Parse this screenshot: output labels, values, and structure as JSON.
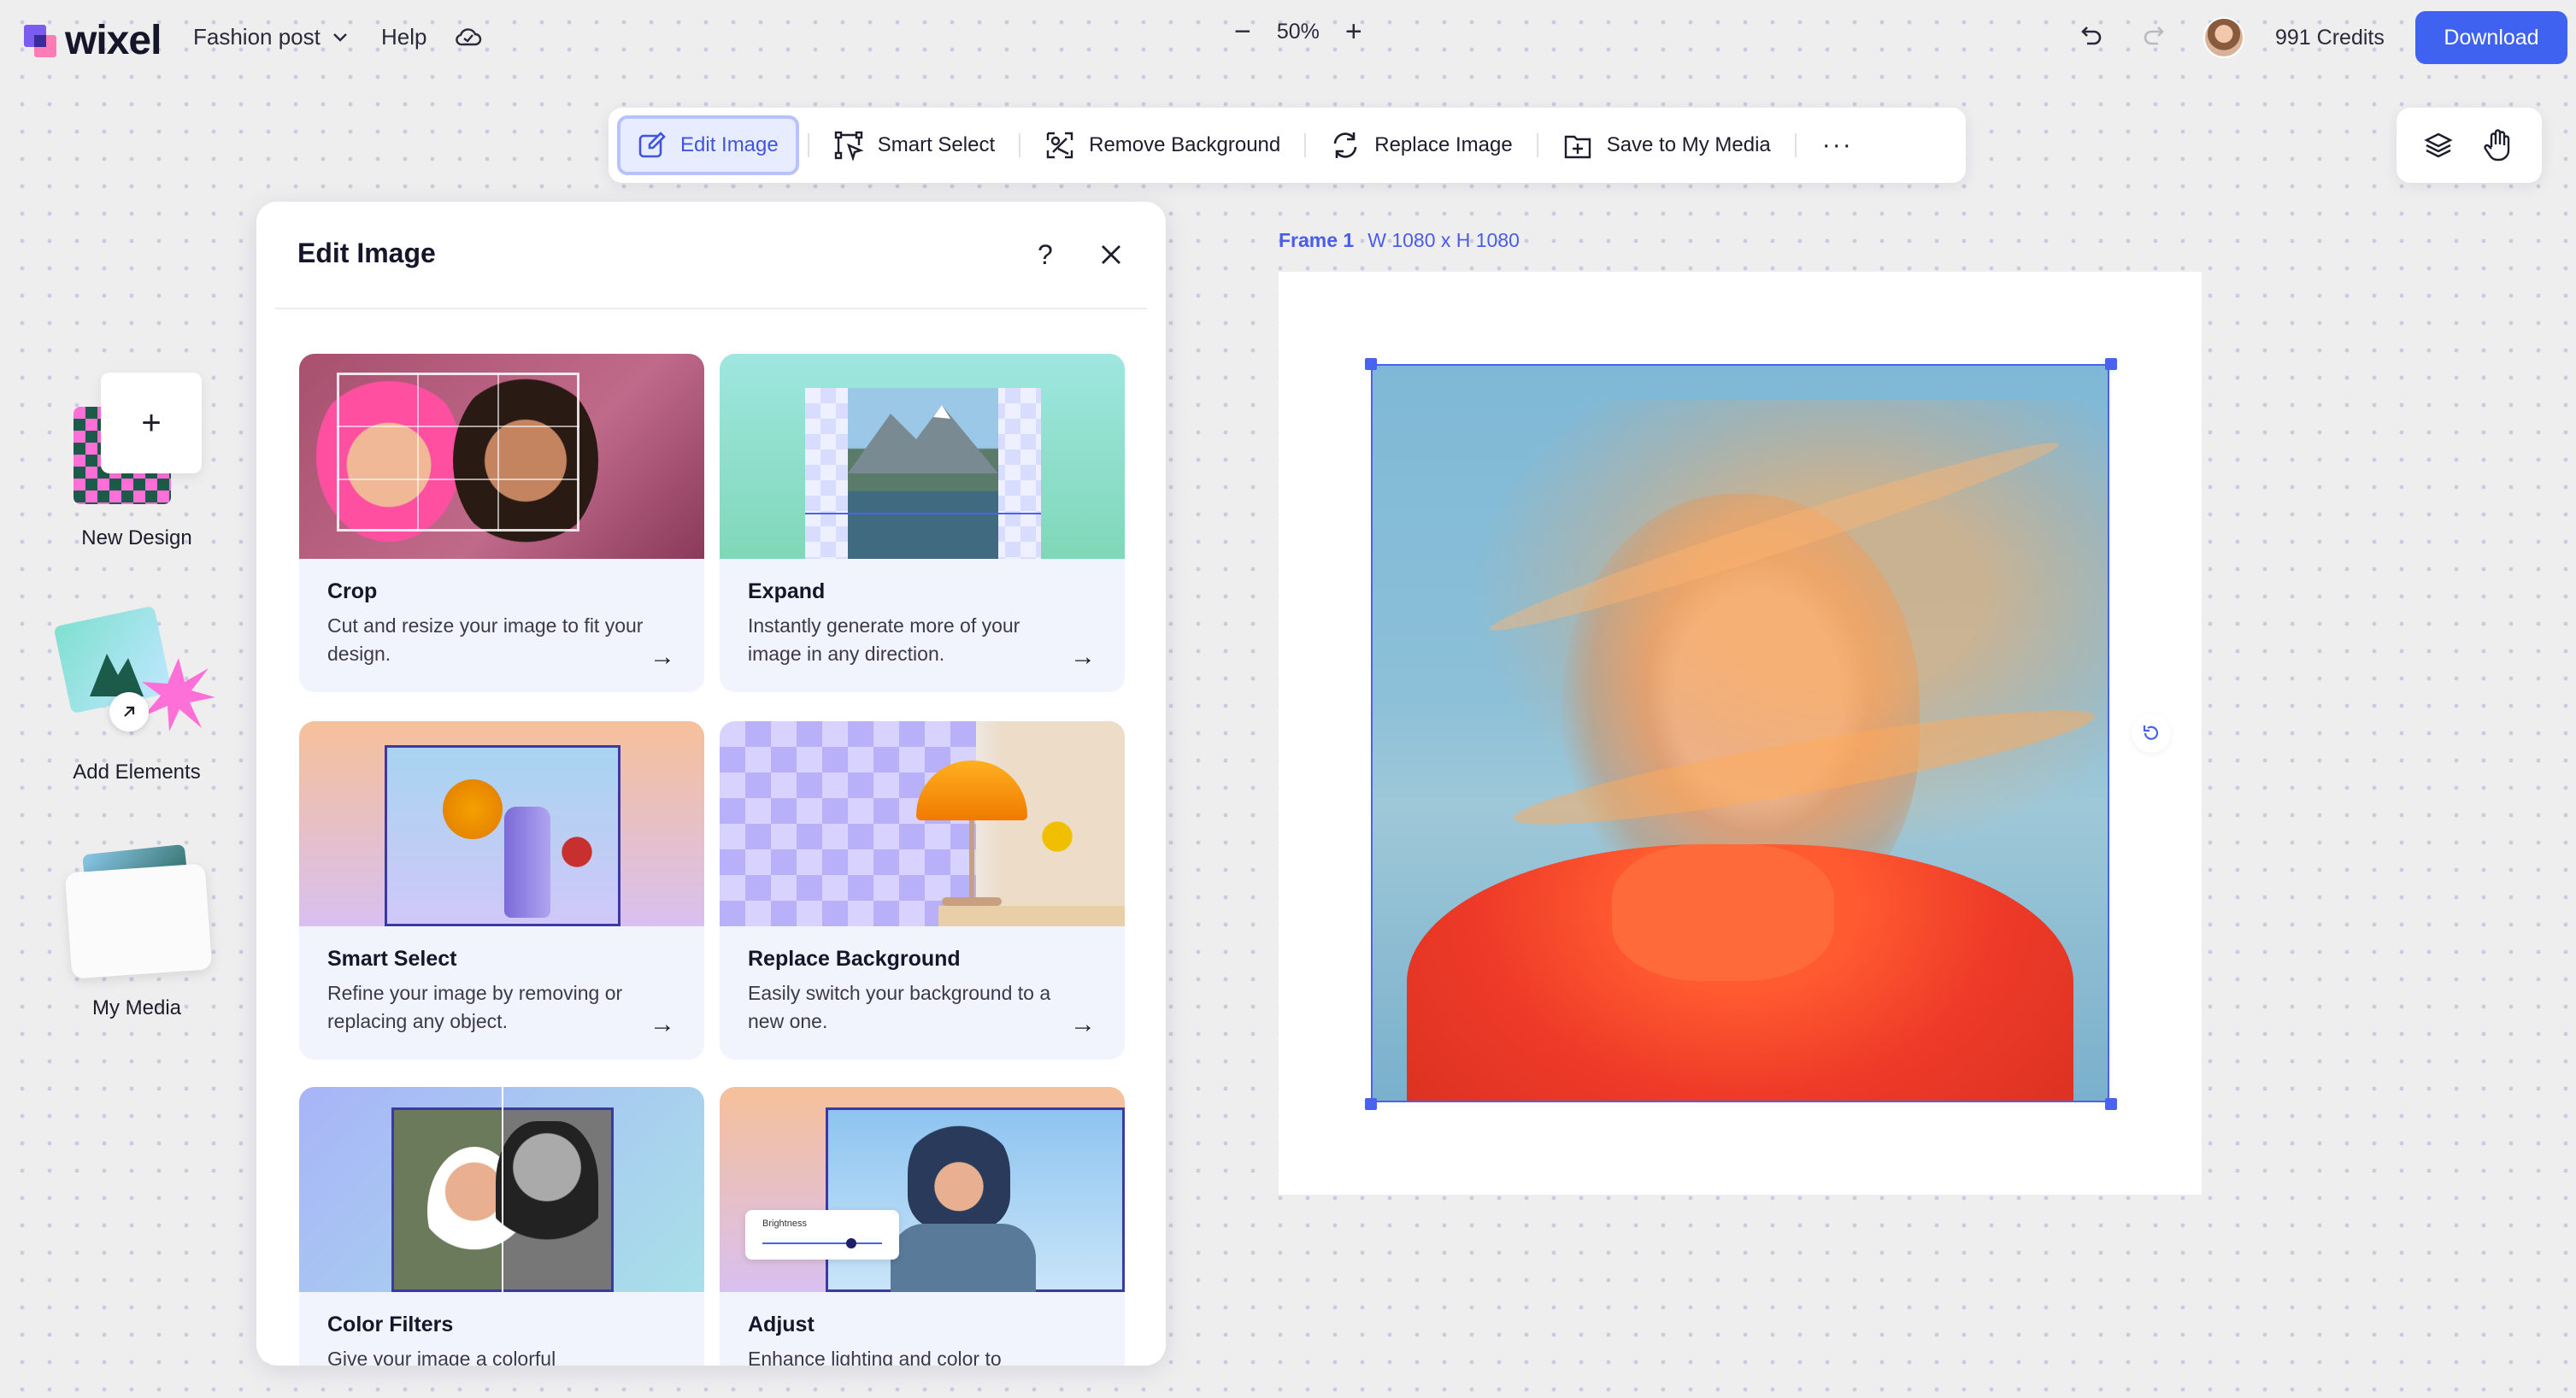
{
  "app": {
    "name": "wixel"
  },
  "topbar": {
    "project_name": "Fashion post",
    "help_label": "Help",
    "zoom_minus": "−",
    "zoom_level": "50%",
    "zoom_plus": "+",
    "credits": "991 Credits",
    "download_label": "Download"
  },
  "toolbar": {
    "items": [
      {
        "label": "Edit Image",
        "icon": "edit-icon",
        "active": true
      },
      {
        "label": "Smart Select",
        "icon": "smart-select-icon"
      },
      {
        "label": "Remove Background",
        "icon": "remove-background-icon"
      },
      {
        "label": "Replace Image",
        "icon": "replace-icon"
      },
      {
        "label": "Save to My Media",
        "icon": "save-media-icon"
      }
    ],
    "more_label": "···"
  },
  "right_tools": [
    "layers-icon",
    "hand-icon"
  ],
  "rail": {
    "new_design": "New Design",
    "add_elements": "Add Elements",
    "my_media": "My Media"
  },
  "panel": {
    "title": "Edit Image",
    "help": "?",
    "cards": [
      {
        "title": "Crop",
        "desc": "Cut and resize your image to fit your design.",
        "arrow": "→"
      },
      {
        "title": "Expand",
        "desc": "Instantly generate more of your image in any direction.",
        "arrow": "→"
      },
      {
        "title": "Smart Select",
        "desc": "Refine your image by removing or replacing any object.",
        "arrow": "→"
      },
      {
        "title": "Replace Background",
        "desc": "Easily switch your background to a new one.",
        "arrow": "→"
      },
      {
        "title": "Color Filters",
        "desc": "Give your image a colorful",
        "arrow": ""
      },
      {
        "title": "Adjust",
        "desc": "Enhance lighting and color to",
        "arrow": ""
      }
    ],
    "adjust_chip": "Brightness"
  },
  "canvas": {
    "frame_name": "Frame 1",
    "frame_size": "W 1080 x H 1080"
  },
  "colors": {
    "accent": "#3f63f0",
    "selection": "#4a62f0",
    "panel_card": "#f2f4fd"
  }
}
